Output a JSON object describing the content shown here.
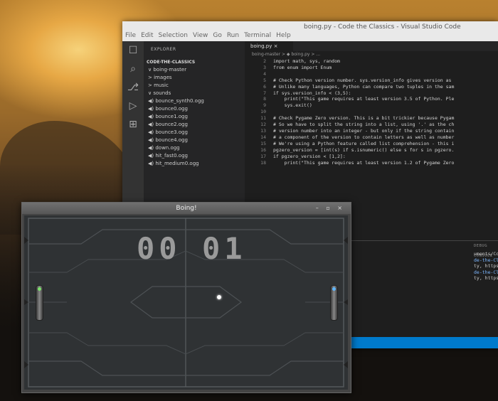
{
  "vscode": {
    "window_title": "boing.py - Code the Classics - Visual Studio Code",
    "menu": [
      "File",
      "Edit",
      "Selection",
      "View",
      "Go",
      "Run",
      "Terminal",
      "Help"
    ],
    "explorer_header": "EXPLORER",
    "project": "CODE-THE-CLASSICS",
    "tree": [
      "∨ boing-master",
      "  > images",
      "  > music",
      "  ∨ sounds",
      "    ◀) bounce_synth0.ogg",
      "    ◀) bounce0.ogg",
      "    ◀) bounce1.ogg",
      "    ◀) bounce2.ogg",
      "    ◀) bounce3.ogg",
      "    ◀) bounce4.ogg",
      "    ◀) down.ogg",
      "    ◀) hit_fast0.ogg",
      "    ◀) hit_medium0.ogg"
    ],
    "tab": "boing.py",
    "breadcrumb": "boing-master > ◆ boing.py > ...",
    "code": [
      {
        "n": "2",
        "t": "import math, sys, random"
      },
      {
        "n": "3",
        "t": "from enum import Enum"
      },
      {
        "n": "4",
        "t": ""
      },
      {
        "n": "5",
        "t": "# Check Python version number. sys.version_info gives version as"
      },
      {
        "n": "6",
        "t": "# Unlike many languages, Python can compare two tuples in the sam"
      },
      {
        "n": "7",
        "t": "if sys.version_info < (3,5):"
      },
      {
        "n": "8",
        "t": "    print(\"This game requires at least version 3.5 of Python. Ple"
      },
      {
        "n": "9",
        "t": "    sys.exit()"
      },
      {
        "n": "10",
        "t": ""
      },
      {
        "n": "11",
        "t": "# Check Pygame Zero version. This is a bit trickier because Pygam"
      },
      {
        "n": "12",
        "t": "# So we have to split the string into a list, using '.' as the ch"
      },
      {
        "n": "13",
        "t": "# version number into an integer - but only if the string contain"
      },
      {
        "n": "14",
        "t": "# a component of the version to contain letters as well as number"
      },
      {
        "n": "15",
        "t": "# We're using a Python feature called list comprehension - this i"
      },
      {
        "n": "16",
        "t": "pgzero_version = [int(s) if s.isnumeric() else s for s in pgzero."
      },
      {
        "n": "17",
        "t": "if pgzero_version < [1,2]:"
      },
      {
        "n": "18",
        "t": "    print(\"This game requires at least version 1.2 of Pygame Zero"
      }
    ],
    "terminal_header": "DEBUG CONSOLE",
    "terminal": [
      "uments/Code-the-Classics/boing-master/boing.py",
      "de-the-Classics $ /usr/bin/python3 /home/pi/Do",
      "",
      "ty, https://www.pygame.org/contribute.html",
      "de-the-Classics $ /usr/bin/python3 /home/pi/Do",
      "",
      "ty, https://www.pygame.org/contribute.html"
    ]
  },
  "game": {
    "window_title": "Boing!",
    "controls": "– ▫ ×",
    "score_left": "00",
    "score_right": "01"
  }
}
